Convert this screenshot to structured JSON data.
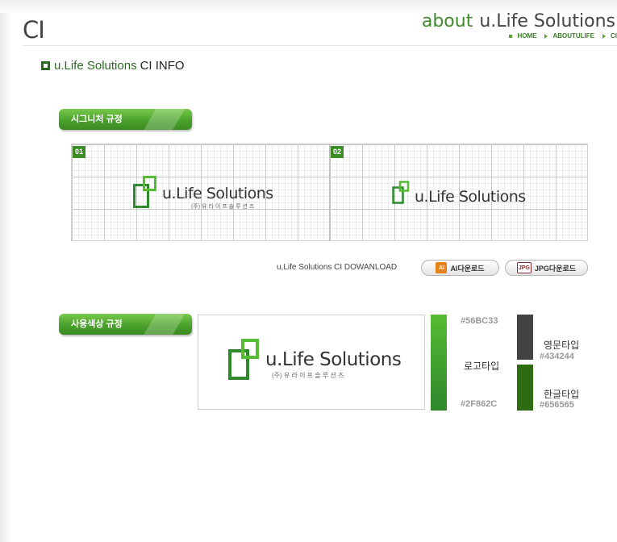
{
  "page": {
    "title": "CI"
  },
  "header": {
    "about": "about",
    "brand": "u.Life Solutions",
    "breadcrumb": {
      "home": "HOME",
      "about": "ABOUTULIFE",
      "current": "CI"
    }
  },
  "section": {
    "title_green": "u.Life Solutions",
    "title_rest": "CI INFO"
  },
  "signature": {
    "label": "시그니처 규정",
    "items": [
      {
        "num": "01",
        "name": "u.Life Solutions",
        "sub": "(주) 유 라 이 프 솔 루 션 즈"
      },
      {
        "num": "02",
        "name": "u.Life Solutions"
      }
    ]
  },
  "download": {
    "label": "u,Life Solutions CI DOWANLOAD",
    "ai_button": "AI다운로드",
    "jpg_button": "JPG다운로드",
    "ai_icon": "AI",
    "jpg_icon": "JPG"
  },
  "colors": {
    "label": "사용색상 규정",
    "logo": {
      "name": "u.Life Solutions",
      "sub": "(주) 유 라 이 프 솔 루 션 즈"
    },
    "logo_type": {
      "label": "로고타입",
      "top": "#56BC33",
      "bottom": "#2F862C"
    },
    "english_type": {
      "label": "영문타입",
      "hex": "#434244",
      "swatch": "#434244"
    },
    "korean_type": {
      "label": "한글타입",
      "hex": "#656565",
      "swatch": "#2E6B12"
    }
  }
}
